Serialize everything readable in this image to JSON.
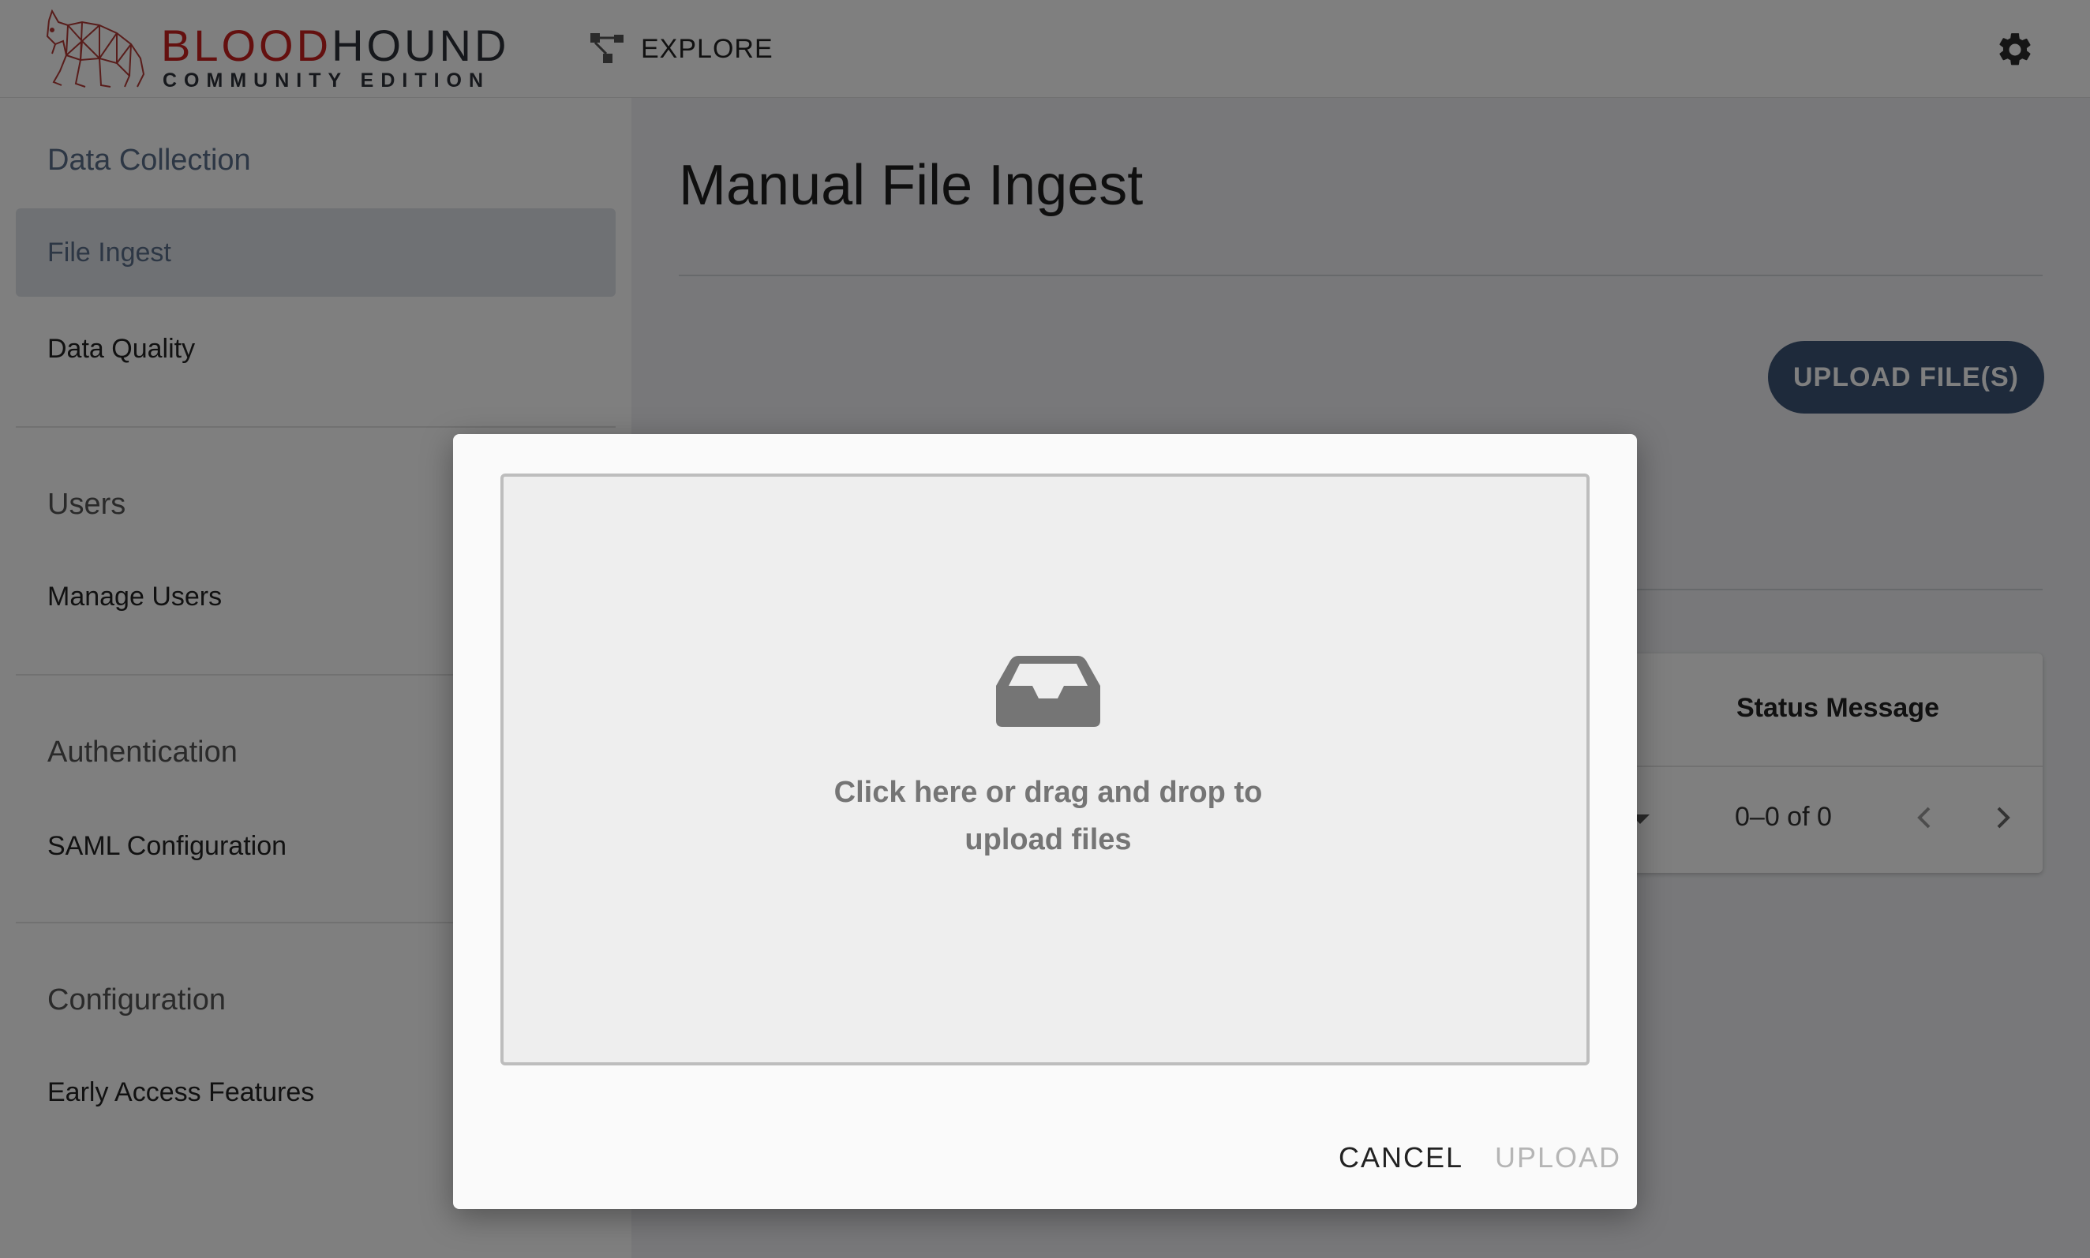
{
  "header": {
    "brand_primary": "BLOOD",
    "brand_secondary": "HOUND",
    "brand_sub": "COMMUNITY EDITION",
    "nav_explore_label": "EXPLORE",
    "icons": {
      "logo": "bloodhound-dog-logo",
      "explore": "graph-network-icon",
      "settings": "gear-icon"
    }
  },
  "sidebar": {
    "sections": [
      {
        "title": "Data Collection",
        "items": [
          "File Ingest",
          "Data Quality"
        ]
      },
      {
        "title": "Users",
        "items": [
          "Manage Users"
        ]
      },
      {
        "title": "Authentication",
        "items": [
          "SAML Configuration"
        ]
      },
      {
        "title": "Configuration",
        "items": [
          "Early Access Features"
        ]
      }
    ],
    "selected_item": "File Ingest"
  },
  "main": {
    "title": "Manual File Ingest",
    "upload_button_label": "UPLOAD FILE(S)",
    "table": {
      "visible_column": "Status Message",
      "pagination_text": "0–0 of 0"
    }
  },
  "modal": {
    "dropzone_line1": "Click here or drag and drop to",
    "dropzone_line2": "upload files",
    "cancel_label": "CANCEL",
    "upload_label": "UPLOAD",
    "upload_disabled": true
  },
  "colors": {
    "brand_red": "#c8201e",
    "primary_button": "#3d5577",
    "selected_nav_bg": "#dfe2e8",
    "overlay": "rgba(0,0,0,0.5)"
  }
}
